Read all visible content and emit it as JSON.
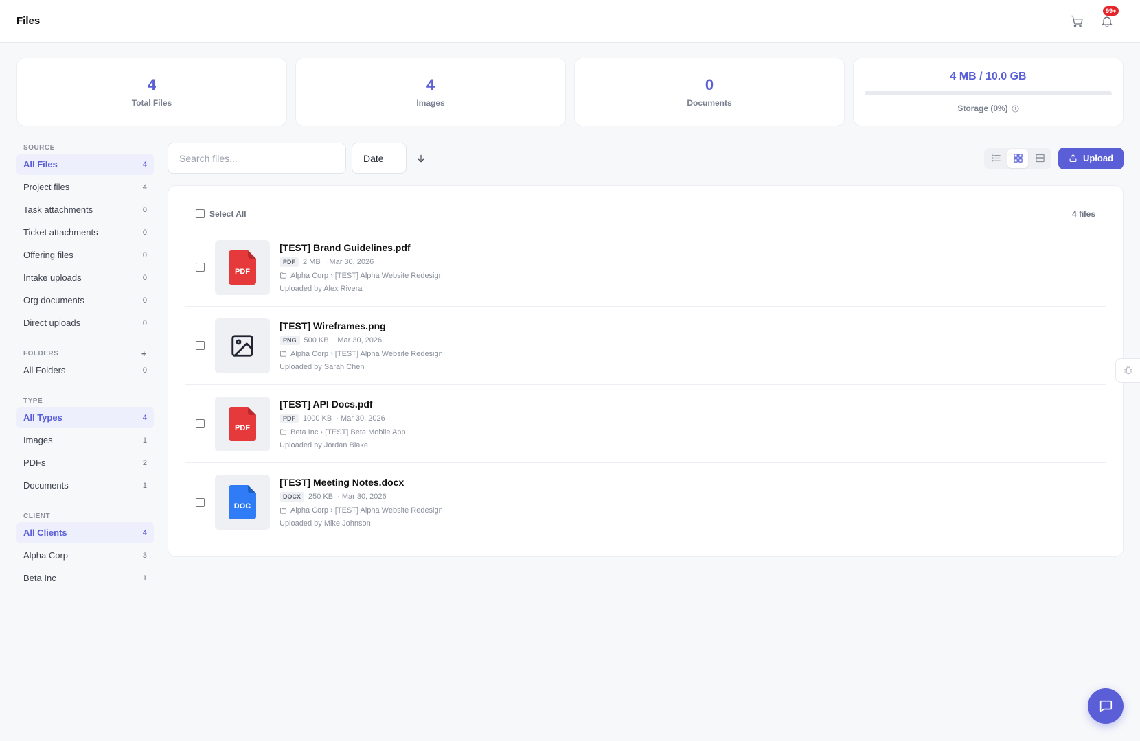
{
  "header": {
    "title": "Files",
    "notification_badge": "99+"
  },
  "stats": [
    {
      "value": "4",
      "label": "Total Files"
    },
    {
      "value": "4",
      "label": "Images"
    },
    {
      "value": "0",
      "label": "Documents"
    }
  ],
  "storage": {
    "value": "4 MB / 10.0 GB",
    "label": "Storage (0%)",
    "used_fraction": 0.0004
  },
  "sidebar": {
    "source": {
      "heading": "SOURCE",
      "items": [
        {
          "label": "All Files",
          "count": "4",
          "active": true
        },
        {
          "label": "Project files",
          "count": "4"
        },
        {
          "label": "Task attachments",
          "count": "0"
        },
        {
          "label": "Ticket attachments",
          "count": "0"
        },
        {
          "label": "Offering files",
          "count": "0"
        },
        {
          "label": "Intake uploads",
          "count": "0"
        },
        {
          "label": "Org documents",
          "count": "0"
        },
        {
          "label": "Direct uploads",
          "count": "0"
        }
      ]
    },
    "folders": {
      "heading": "FOLDERS",
      "add_label": "+",
      "items": [
        {
          "label": "All Folders",
          "count": "0"
        }
      ]
    },
    "type": {
      "heading": "TYPE",
      "items": [
        {
          "label": "All Types",
          "count": "4",
          "active": true
        },
        {
          "label": "Images",
          "count": "1"
        },
        {
          "label": "PDFs",
          "count": "2"
        },
        {
          "label": "Documents",
          "count": "1"
        }
      ]
    },
    "client": {
      "heading": "CLIENT",
      "items": [
        {
          "label": "All Clients",
          "count": "4",
          "active": true
        },
        {
          "label": "Alpha Corp",
          "count": "3"
        },
        {
          "label": "Beta Inc",
          "count": "1"
        }
      ]
    }
  },
  "toolbar": {
    "search_placeholder": "Search files...",
    "sort_value": "Date",
    "upload_label": "Upload",
    "active_view": "grid"
  },
  "list": {
    "select_all_label": "Select All",
    "count_label": "4 files",
    "files": [
      {
        "name": "[TEST] Brand Guidelines.pdf",
        "ext": "PDF",
        "size": "2 MB",
        "date": "· Mar 30, 2026",
        "path": "Alpha Corp › [TEST] Alpha Website Redesign",
        "uploader": "Uploaded by Alex Rivera",
        "thumb": "pdf",
        "thumb_label": "PDF"
      },
      {
        "name": "[TEST] Wireframes.png",
        "ext": "PNG",
        "size": "500 KB",
        "date": "· Mar 30, 2026",
        "path": "Alpha Corp › [TEST] Alpha Website Redesign",
        "uploader": "Uploaded by Sarah Chen",
        "thumb": "image",
        "thumb_label": ""
      },
      {
        "name": "[TEST] API Docs.pdf",
        "ext": "PDF",
        "size": "1000 KB",
        "date": "· Mar 30, 2026",
        "path": "Beta Inc › [TEST] Beta Mobile App",
        "uploader": "Uploaded by Jordan Blake",
        "thumb": "pdf",
        "thumb_label": "PDF"
      },
      {
        "name": "[TEST] Meeting Notes.docx",
        "ext": "DOCX",
        "size": "250 KB",
        "date": "· Mar 30, 2026",
        "path": "Alpha Corp › [TEST] Alpha Website Redesign",
        "uploader": "Uploaded by Mike Johnson",
        "thumb": "doc",
        "thumb_label": "DOC"
      }
    ]
  },
  "colors": {
    "accent": "#5a5fd8",
    "pdf_red": "#e5393b",
    "doc_blue": "#2f7cf6",
    "badge_red": "#e5252a"
  }
}
